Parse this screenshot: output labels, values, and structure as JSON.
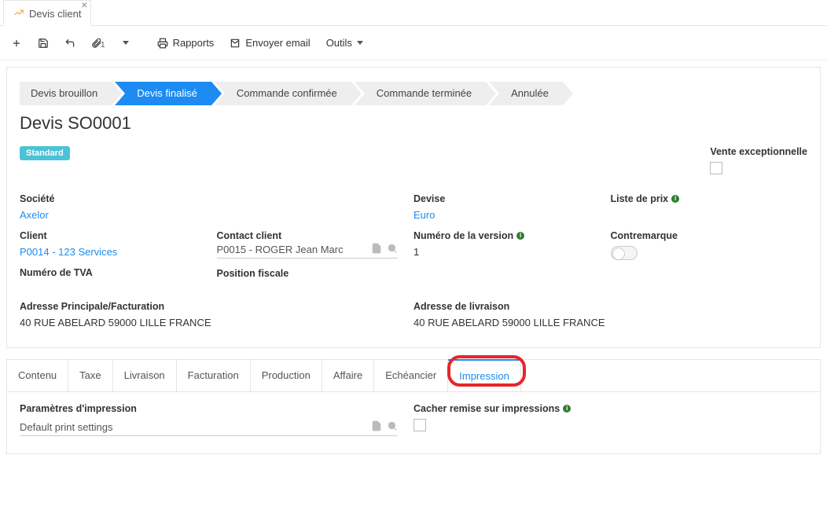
{
  "appTab": {
    "label": "Devis client"
  },
  "toolbar": {
    "attachCount": "1",
    "reportsLabel": "Rapports",
    "sendEmailLabel": "Envoyer email",
    "toolsLabel": "Outils"
  },
  "workflow": {
    "steps": [
      {
        "label": "Devis brouillon"
      },
      {
        "label": "Devis finalisé",
        "active": true
      },
      {
        "label": "Commande confirmée"
      },
      {
        "label": "Commande terminée"
      },
      {
        "label": "Annulée"
      }
    ]
  },
  "record": {
    "title": "Devis SO0001",
    "badge": "Standard",
    "exceptionalSaleLabel": "Vente exceptionnelle",
    "fields": {
      "companyLabel": "Société",
      "companyValue": "Axelor",
      "clientLabel": "Client",
      "clientValue": "P0014 - 123 Services",
      "vatLabel": "Numéro de TVA",
      "contactLabel": "Contact client",
      "contactValue": "P0015 - ROGER Jean Marc",
      "fiscalPosLabel": "Position fiscale",
      "currencyLabel": "Devise",
      "currencyValue": "Euro",
      "versionLabel": "Numéro de la version",
      "versionValue": "1",
      "priceListLabel": "Liste de prix",
      "countermarkLabel": "Contremarque",
      "mainAddressLabel": "Adresse Principale/Facturation",
      "mainAddressValue": "40 RUE ABELARD 59000 LILLE FRANCE",
      "deliveryAddressLabel": "Adresse de livraison",
      "deliveryAddressValue": "40 RUE ABELARD 59000 LILLE FRANCE"
    }
  },
  "detailTabs": {
    "items": [
      "Contenu",
      "Taxe",
      "Livraison",
      "Facturation",
      "Production",
      "Affaire",
      "Echéancier",
      "Impression"
    ],
    "activeIndex": 7,
    "printSettingsLabel": "Paramètres d'impression",
    "printSettingsValue": "Default print settings",
    "hideDiscountLabel": "Cacher remise sur impressions"
  }
}
